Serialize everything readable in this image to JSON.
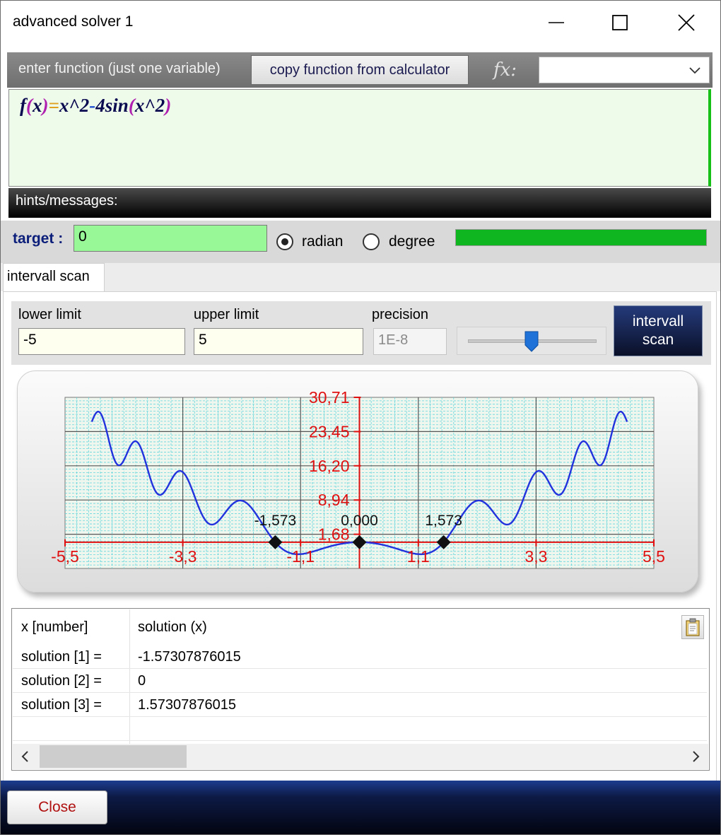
{
  "window": {
    "title": "advanced solver 1",
    "controls": [
      "minimize-icon",
      "maximize-icon",
      "close-icon"
    ]
  },
  "function_editor": {
    "label": "enter function (just one variable)",
    "copy_button": "copy function from calculator",
    "fx_label": "fx:",
    "fx_select_value": "",
    "expression": {
      "f": "f",
      "lparen1": "(",
      "x1": "x",
      "rparen1": ")",
      "eq": "=",
      "body1": "x^2",
      "minus": "-",
      "body2": "4sin",
      "lparen2": "(",
      "body3": "x^2",
      "rparen2": ")"
    },
    "hints_label": "hints/messages:"
  },
  "target": {
    "label": "target",
    "colon": ":",
    "value": "0",
    "radian_label": "radian",
    "degree_label": "degree",
    "selected": "radian",
    "progress": 1.0,
    "colors": {
      "input_bg": "#98f898",
      "progress": "#0fb61f"
    }
  },
  "tabs": [
    {
      "label": "intervall scan",
      "active": true
    }
  ],
  "scan": {
    "lower_label": "lower limit",
    "lower_value": "-5",
    "upper_label": "upper limit",
    "upper_value": "5",
    "precision_label": "precision",
    "precision_value": "1E-8",
    "slider_value": 0.5,
    "scan_button_line1": "intervall",
    "scan_button_line2": "scan"
  },
  "chart_data": {
    "type": "line",
    "function": "x^2-4sin(x^2)",
    "xlim": [
      -5.5,
      5.5
    ],
    "ylim": [
      -5.57,
      30.71
    ],
    "x_ticks": [
      "-5,5",
      "-3,3",
      "-1,1",
      "1,1",
      "3,3",
      "5,5"
    ],
    "x_tick_values": [
      -5.5,
      -3.3,
      -1.1,
      1.1,
      3.3,
      5.5
    ],
    "y_ticks": [
      "30,71",
      "23,45",
      "16,20",
      "8,94",
      "1,68"
    ],
    "y_tick_values": [
      30.71,
      23.45,
      16.2,
      8.94,
      1.68
    ],
    "series": [
      {
        "x_range": [
          -5,
          5
        ]
      }
    ],
    "roots": [
      {
        "x": -1.573,
        "label": "-1,573"
      },
      {
        "x": 0.0,
        "label": "0,000"
      },
      {
        "x": 1.573,
        "label": "1,573"
      }
    ],
    "grid": true,
    "colors": {
      "line": "#2233dd",
      "axis": "#e01010",
      "tick_text": "#e01010",
      "major_grid": "#555555",
      "minor_grid": "#66d6dc",
      "plot_bg": "#eef6ee"
    }
  },
  "results": {
    "columns": [
      "x [number]",
      "solution (x)"
    ],
    "rows": [
      {
        "label": "solution [1] =",
        "value": "-1.57307876015"
      },
      {
        "label": "solution [2] =",
        "value": "0"
      },
      {
        "label": "solution [3] =",
        "value": "1.57307876015"
      }
    ],
    "scroll_left": "‹",
    "scroll_right": "›"
  },
  "footer": {
    "close_button": "Close"
  }
}
